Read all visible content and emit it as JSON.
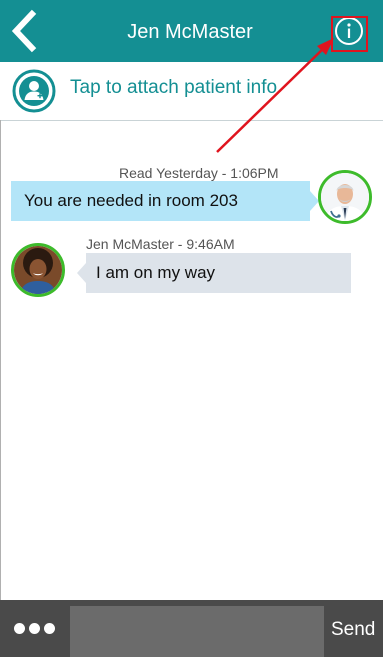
{
  "header": {
    "title": "Jen McMaster",
    "back_icon": "chevron-left-icon",
    "info_icon": "info-circle-icon",
    "background_color": "#148f93"
  },
  "attach": {
    "label": "Tap to attach patient info",
    "icon": "patient-user-icon",
    "accent_color": "#148f93"
  },
  "messages": [
    {
      "direction": "outgoing",
      "meta": "Read Yesterday - 1:06PM",
      "text": "You are needed in room 203",
      "avatar": "doctor-avatar",
      "bubble_color": "#b3e5f8"
    },
    {
      "direction": "incoming",
      "meta": "Jen McMaster - 9:46AM",
      "text": "I am on my way",
      "avatar": "jen-avatar",
      "bubble_color": "#dde3ea"
    }
  ],
  "composer": {
    "more_icon": "ellipsis-icon",
    "input_value": "",
    "send_label": "Send"
  },
  "annotation": {
    "highlight_color": "#e0141e",
    "avatar_border_color": "#3dbb2b"
  }
}
